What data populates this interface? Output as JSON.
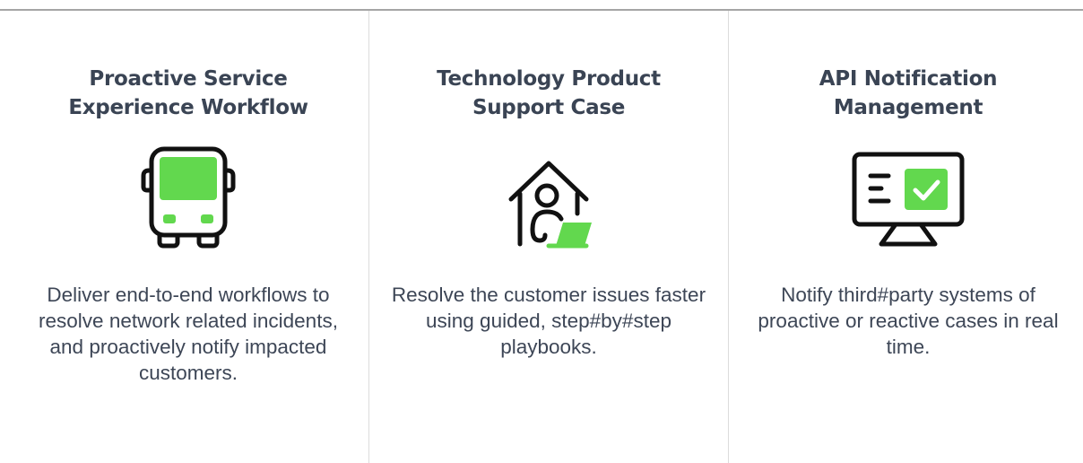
{
  "cards": [
    {
      "title": "Proactive Service Experience Workflow",
      "icon": "bus-icon",
      "description": "Deliver end-to-end workflows to resolve network related incidents, and proactively notify impacted customers."
    },
    {
      "title": "Technology Product Support Case",
      "icon": "home-support-agent-icon",
      "description": "Resolve the customer issues faster using guided, step#by#step playbooks."
    },
    {
      "title": "API Notification Management",
      "icon": "monitor-checkmark-icon",
      "description": "Notify third#party systems of proactive or reactive cases in real time."
    }
  ],
  "colors": {
    "accent": "#62d84e",
    "title": "#3a4454",
    "text": "#3d4656",
    "icon_stroke": "#111111"
  }
}
